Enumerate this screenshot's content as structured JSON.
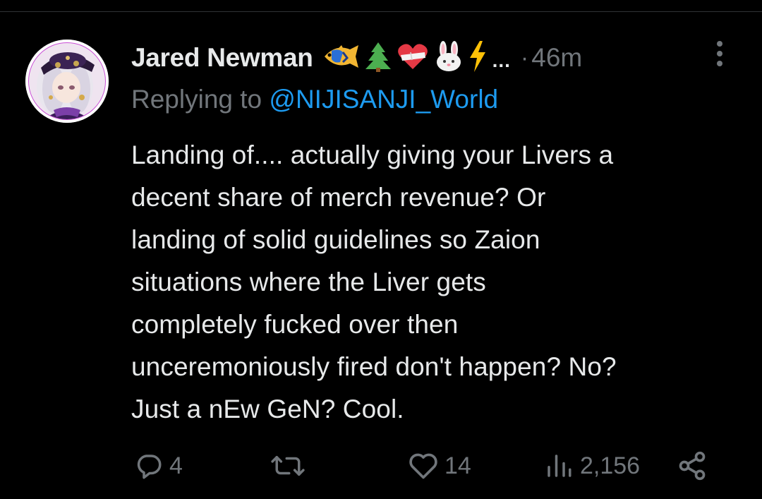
{
  "tweet": {
    "author_name": "Jared Newman",
    "name_emojis": [
      "fish-emoji",
      "christmas-tree-emoji",
      "mended-heart-emoji",
      "rabbit-face-emoji",
      "lightning-emoji"
    ],
    "name_overflow": "...",
    "dot": "·",
    "time": "46m",
    "replying_prefix": "Replying to",
    "replying_handle": "@NIJISANJI_World",
    "text": "Landing of.... actually giving your Livers a\ndecent share of merch revenue? Or\nlanding of solid guidelines so Zaion\nsituations where the Liver gets\ncompletely fucked over then\nunceremoniously fired don't happen? No?\nJust a nEw GeN? Cool."
  },
  "actions": {
    "replies": "4",
    "retweets": "",
    "likes": "14",
    "views": "2,156"
  },
  "icons": {
    "reply": "reply-icon",
    "retweet": "retweet-icon",
    "like": "heart-icon",
    "views": "views-bar-chart-icon",
    "share": "share-icon",
    "more": "more-vertical-icon"
  },
  "colors": {
    "background": "#000000",
    "primary_text": "#e7e9ea",
    "secondary_text": "#71767b",
    "link": "#1d9bf0",
    "avatar_ring": "#ffffff"
  }
}
